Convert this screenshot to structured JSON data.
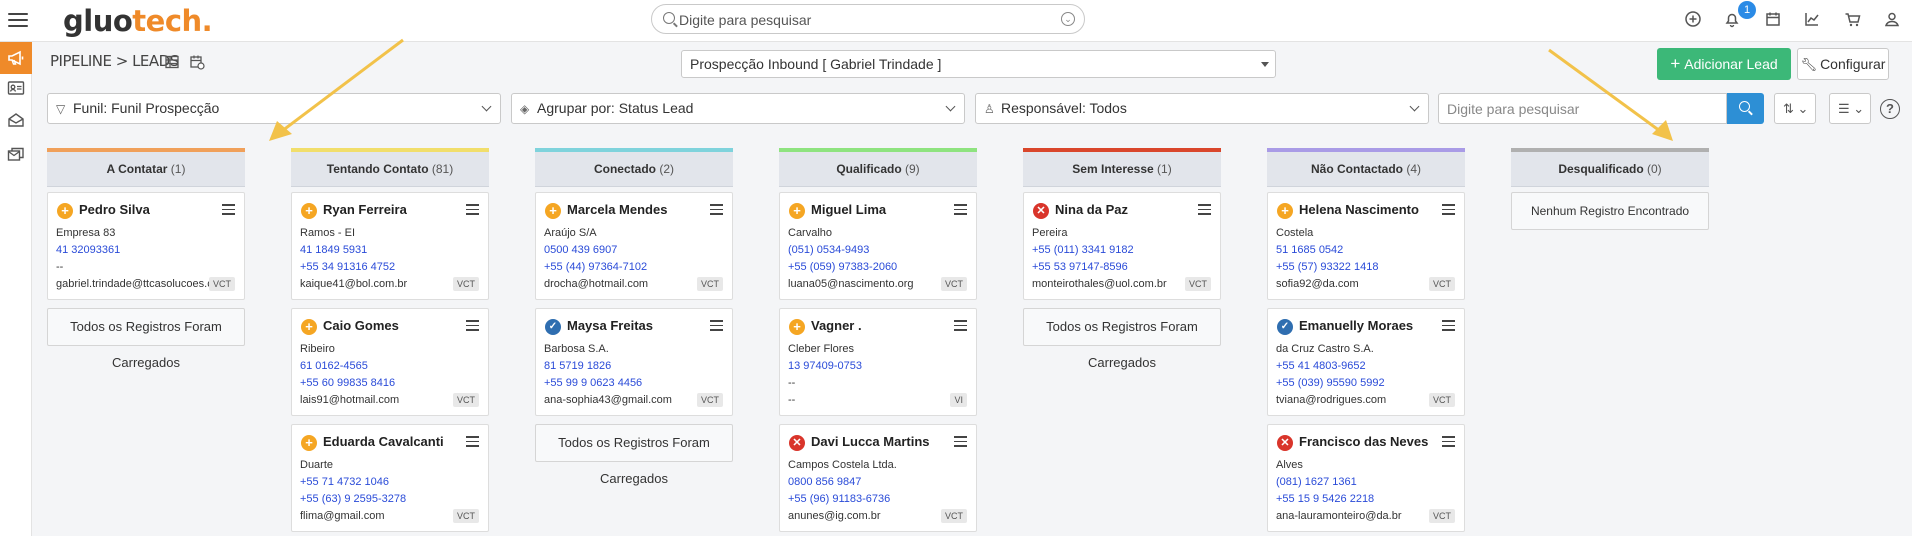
{
  "header": {
    "logo_a": "gluo",
    "logo_b": "tech.",
    "search_placeholder": "Digite para pesquisar",
    "notification_count": "1"
  },
  "breadcrumb": "PIPELINE > LEADS",
  "pipeline_select": "Prospecção Inbound [ Gabriel Trindade ]",
  "actions": {
    "add_lead": "Adicionar Lead",
    "configure": "Configurar"
  },
  "filters": {
    "funnel": "Funil: Funil Prospecção",
    "group_by": "Agrupar por: Status Lead",
    "responsible": "Responsável: Todos",
    "search_placeholder": "Digite para pesquisar"
  },
  "loaded_text": "Todos os Registros Foram Carregados",
  "empty_text": "Nenhum Registro Encontrado",
  "columns": [
    {
      "title": "A Contatar",
      "count": "(1)",
      "color": "#f0a05a",
      "cards": [
        {
          "status": "plus",
          "name": "Pedro Silva",
          "company": "Empresa 83",
          "phone1": "41 32093361",
          "phone2": "--",
          "email": "gabriel.trindade@ttcasolucoes.co...",
          "tag": "VCT"
        }
      ]
    },
    {
      "title": "Tentando Contato",
      "count": "(81)",
      "color": "#f1de6b",
      "cards": [
        {
          "status": "plus",
          "name": "Ryan Ferreira",
          "company": "Ramos - EI",
          "phone1": "41 1849 5931",
          "phone2": "+55 34 91316 4752",
          "email": "kaique41@bol.com.br",
          "tag": "VCT"
        },
        {
          "status": "plus",
          "name": "Caio Gomes",
          "company": "Ribeiro",
          "phone1": "61 0162-4565",
          "phone2": "+55 60 99835 8416",
          "email": "lais91@hotmail.com",
          "tag": "VCT"
        },
        {
          "status": "plus",
          "name": "Eduarda Cavalcanti",
          "company": "Duarte",
          "phone1": "+55 71 4732 1046",
          "phone2": "+55 (63) 9 2595-3278",
          "email": "flima@gmail.com",
          "tag": "VCT"
        }
      ]
    },
    {
      "title": "Conectado",
      "count": "(2)",
      "color": "#7fd3dc",
      "cards": [
        {
          "status": "plus",
          "name": "Marcela Mendes",
          "company": "Araújo S/A",
          "phone1": "0500 439 6907",
          "phone2": "+55 (44) 97364-7102",
          "email": "drocha@hotmail.com",
          "tag": "VCT"
        },
        {
          "status": "check",
          "name": "Maysa Freitas",
          "company": "Barbosa S.A.",
          "phone1": "81 5719 1826",
          "phone2": "+55 99 9 0623 4456",
          "email": "ana-sophia43@gmail.com",
          "tag": "VCT"
        }
      ]
    },
    {
      "title": "Qualificado",
      "count": "(9)",
      "color": "#8ee37f",
      "cards": [
        {
          "status": "plus",
          "name": "Miguel Lima",
          "company": "Carvalho",
          "phone1": "(051) 0534-9493",
          "phone2": "+55 (059) 97383-2060",
          "email": "luana05@nascimento.org",
          "tag": "VCT"
        },
        {
          "status": "plus",
          "name": "Vagner .",
          "company": "Cleber Flores",
          "phone1": "13 97409-0753",
          "phone2": "--",
          "email": "--",
          "tag": "VI"
        },
        {
          "status": "x",
          "name": "Davi Lucca Martins",
          "company": "Campos Costela Ltda.",
          "phone1": "0800 856 9847",
          "phone2": "+55 (96) 91183-6736",
          "email": "anunes@ig.com.br",
          "tag": "VCT"
        }
      ]
    },
    {
      "title": "Sem Interesse",
      "count": "(1)",
      "color": "#d9462b",
      "cards": [
        {
          "status": "x",
          "name": "Nina da Paz",
          "company": "Pereira",
          "phone1": "+55 (011) 3341 9182",
          "phone2": "+55 53 97147-8596",
          "email": "monteirothales@uol.com.br",
          "tag": "VCT"
        }
      ]
    },
    {
      "title": "Não Contactado",
      "count": "(4)",
      "color": "#a99be6",
      "cards": [
        {
          "status": "plus",
          "name": "Helena Nascimento",
          "company": "Costela",
          "phone1": "51 1685 0542",
          "phone2": "+55 (57) 93322 1418",
          "email": "sofia92@da.com",
          "tag": "VCT"
        },
        {
          "status": "check",
          "name": "Emanuelly Moraes",
          "company": "da Cruz Castro S.A.",
          "phone1": "+55 41 4803-9652",
          "phone2": "+55 (039) 95590 5992",
          "email": "tviana@rodrigues.com",
          "tag": "VCT"
        },
        {
          "status": "x",
          "name": "Francisco das Neves",
          "company": "Alves",
          "phone1": "(081) 1627 1361",
          "phone2": "+55 15 9 5426 2218",
          "email": "ana-lauramonteiro@da.br",
          "tag": "VCT"
        }
      ]
    },
    {
      "title": "Desqualificado",
      "count": "(0)",
      "color": "#b0b0b0",
      "cards": []
    }
  ]
}
